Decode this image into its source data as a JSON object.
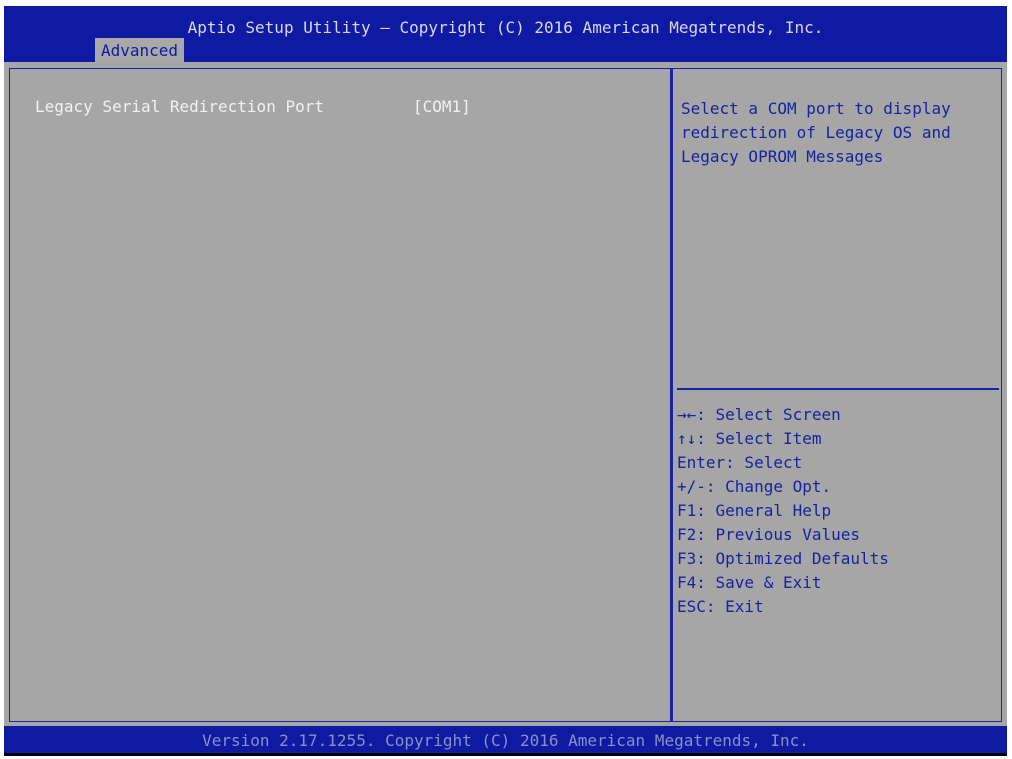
{
  "header": {
    "title": "Aptio Setup Utility – Copyright (C) 2016 American Megatrends, Inc.",
    "tabs": [
      {
        "label": "Advanced",
        "selected": true
      }
    ]
  },
  "main": {
    "settings": [
      {
        "label": "Legacy Serial Redirection Port",
        "value": "[COM1]"
      }
    ]
  },
  "help": {
    "lines": [
      "Select a COM port to display",
      "redirection of Legacy OS and",
      "Legacy OPROM Messages"
    ]
  },
  "keys": [
    "→←: Select Screen",
    "↑↓: Select Item",
    "Enter: Select",
    "+/-: Change Opt.",
    "F1: General Help",
    "F2: Previous Values",
    "F3: Optimized Defaults",
    "F4: Save & Exit",
    "ESC: Exit"
  ],
  "footer": {
    "version": "Version 2.17.1255. Copyright (C) 2016 American Megatrends, Inc."
  },
  "colors": {
    "header_bg": "#0f1aa3",
    "body_bg": "#a6a6a6",
    "setting_text": "#f2f2f2",
    "help_text": "#1622a0"
  }
}
